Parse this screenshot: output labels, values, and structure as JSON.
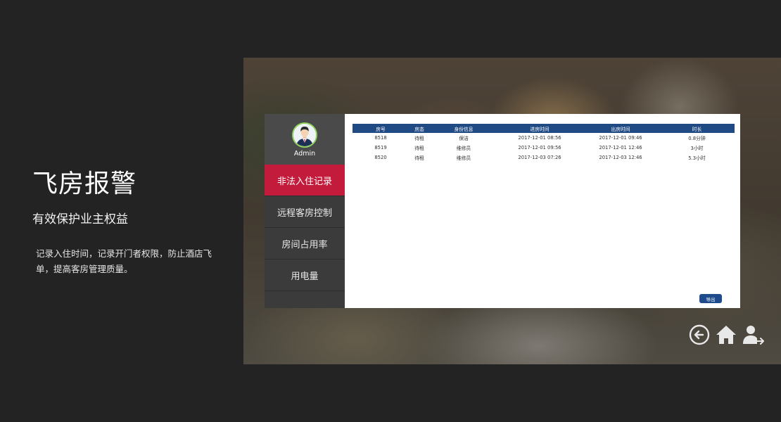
{
  "hero": {
    "title": "飞房报警",
    "subtitle": "有效保护业主权益",
    "description": "记录入住时间，记录开门者权限，防止酒店飞单，提高客房管理质量。"
  },
  "sidebar": {
    "profile_name": "Admin",
    "items": [
      {
        "label": "非法入住记录",
        "active": true
      },
      {
        "label": "远程客房控制",
        "active": false
      },
      {
        "label": "房间占用率",
        "active": false
      },
      {
        "label": "用电量",
        "active": false
      }
    ]
  },
  "table": {
    "columns": [
      "房号",
      "房态",
      "身份信息",
      "进房时间",
      "出房时间",
      "时长"
    ],
    "rows": [
      [
        "8518",
        "待租",
        "保洁",
        "2017-12-01 08:56",
        "2017-12-01 09:46",
        "0.8分钟"
      ],
      [
        "8519",
        "待租",
        "维修员",
        "2017-12-01 09:56",
        "2017-12-01 12:46",
        "3小时"
      ],
      [
        "8520",
        "待租",
        "维修员",
        "2017-12-03 07:26",
        "2017-12-03 12:46",
        "5.3小时"
      ]
    ]
  },
  "export_label": "导出",
  "icons": [
    "back-circle-icon",
    "home-icon",
    "user-logout-icon"
  ],
  "colors": {
    "accent": "#c21b3c",
    "table_header": "#1f4a84",
    "sidebar": "#3b3b3c",
    "page_bg": "#232323"
  }
}
